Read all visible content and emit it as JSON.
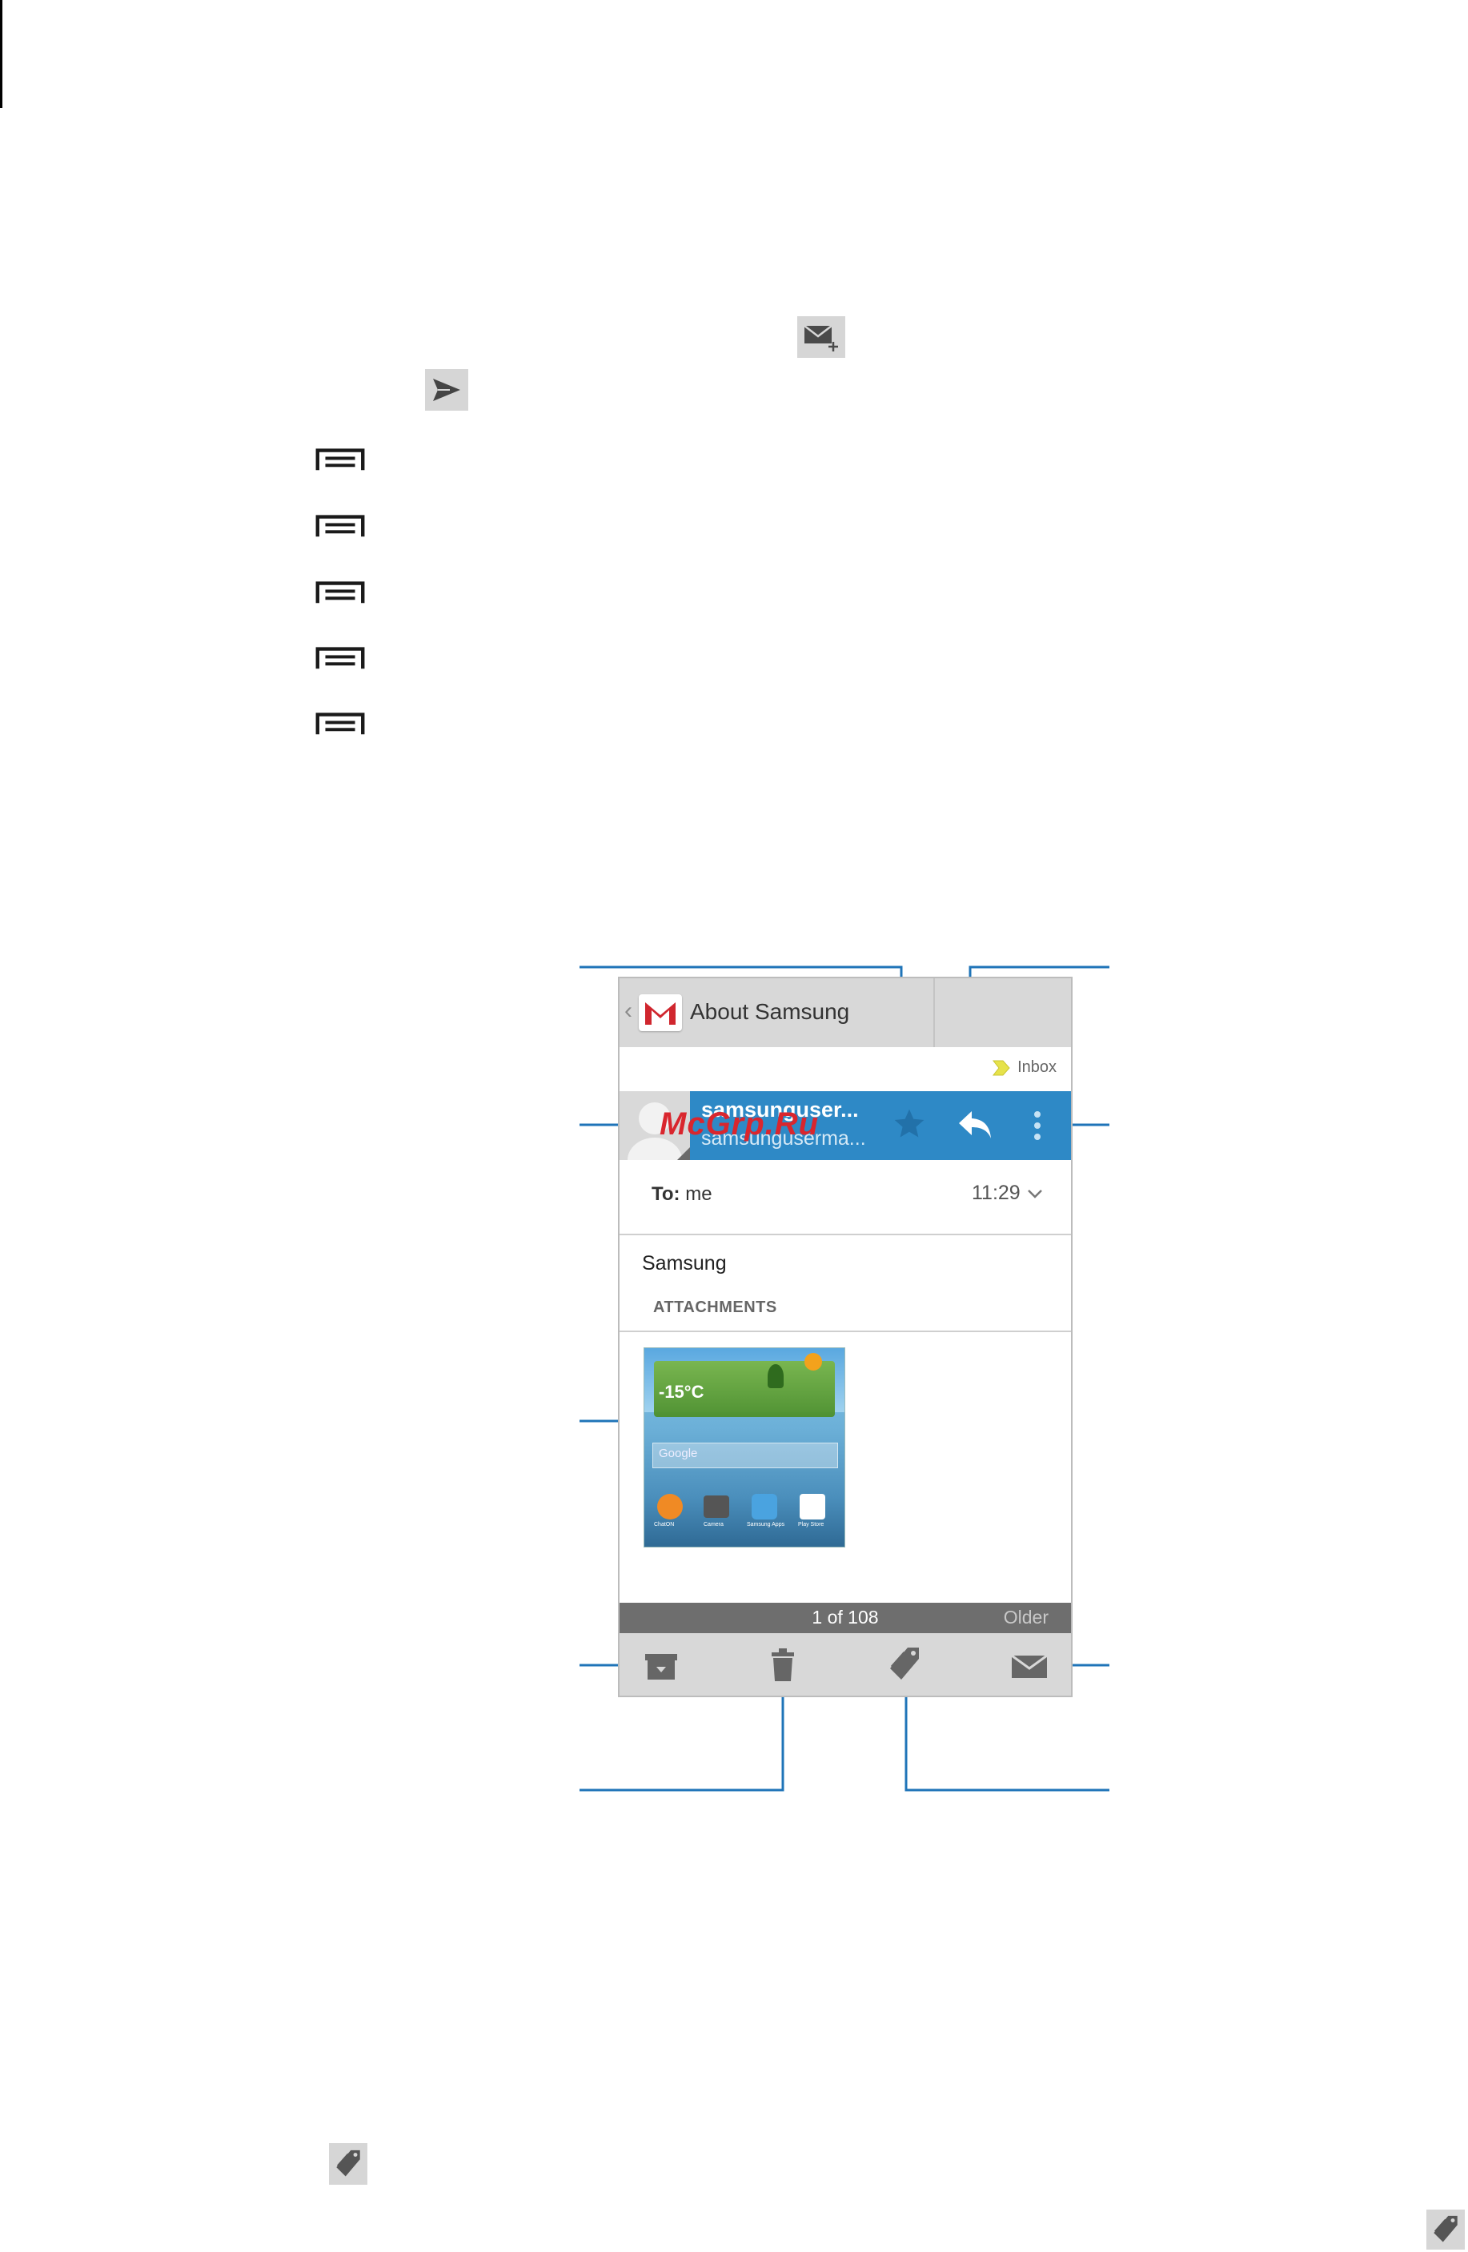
{
  "inline_icons": {
    "compose": "compose-email-icon",
    "send": "send-icon",
    "menu_key": "menu-key-icon",
    "label": "label-tag-icon"
  },
  "email_app": {
    "title": "About Samsung",
    "label_chip": "Inbox",
    "sender": {
      "name": "samsunguser...",
      "email": "samsungusermа..."
    },
    "to_label": "To:",
    "to_value": "me",
    "time": "11:29",
    "subject": "Samsung",
    "attachments_heading": "ATTACHMENTS",
    "pager": "1 of 108",
    "older": "Older",
    "watermark": "McGrp.Ru",
    "attachment_preview": {
      "temperature": "-15°C",
      "search_hint": "Google",
      "apps": [
        "ChatON",
        "Camera",
        "Samsung Apps",
        "Play Store"
      ]
    }
  },
  "colors": {
    "sender_bar": "#2e89c6",
    "callout": "#1f74b8",
    "top_bar": "#d8d8d8",
    "pager": "#6e6e6e",
    "gmail_red": "#d0262e"
  }
}
